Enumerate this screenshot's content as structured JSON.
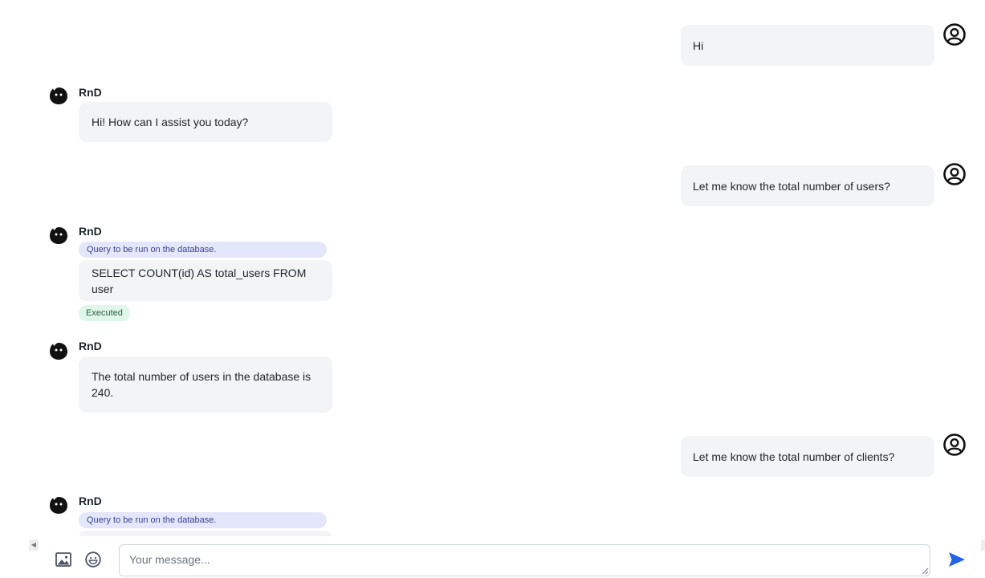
{
  "messages": {
    "user_1": "Hi",
    "bot_name": "RnD",
    "bot_1": "Hi! How can I assist you today?",
    "user_2": "Let me know the total number of users?",
    "query_label": "Query to be run on the database.",
    "query_1": "SELECT COUNT(id) AS total_users FROM user",
    "executed_label": "Executed",
    "bot_2": "The total number of users in the database is 240.",
    "user_3": "Let me know the total number of clients?"
  },
  "input": {
    "placeholder": "Your message..."
  },
  "icons": {
    "user_avatar": "user-circle-icon",
    "bot_avatar": "bot-avatar-icon",
    "image": "image-icon",
    "emoji": "emoji-icon",
    "send": "send-icon"
  },
  "colors": {
    "bubble": "#f3f4f6",
    "query_pill": "#e4e7fb",
    "executed_badge": "#dff6ea",
    "send": "#2563eb"
  }
}
